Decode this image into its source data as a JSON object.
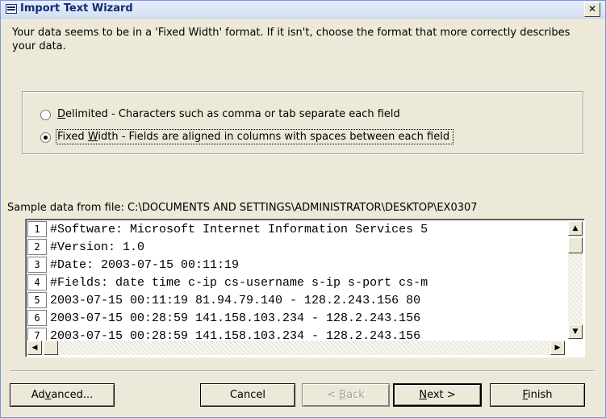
{
  "window": {
    "title": "Import Text Wizard",
    "close_glyph": "✕"
  },
  "intro": "Your data seems to be in a 'Fixed Width' format. If it isn't, choose the format that more correctly describes your data.",
  "options": {
    "delimited": {
      "label_prefix": "",
      "accel": "D",
      "label_rest": "elimited - Characters such as comma or tab separate each field",
      "selected": false
    },
    "fixed_width": {
      "label_prefix": "Fixed ",
      "accel": "W",
      "label_rest": "idth - Fields are aligned in columns with spaces between each field",
      "selected": true
    }
  },
  "sample": {
    "label": "Sample data from file: C:\\DOCUMENTS AND SETTINGS\\ADMINISTRATOR\\DESKTOP\\EX0307",
    "line_numbers": [
      "1",
      "2",
      "3",
      "4",
      "5",
      "6",
      "7"
    ],
    "lines": [
      "#Software: Microsoft Internet Information Services 5",
      "#Version: 1.0",
      "#Date: 2003-07-15 00:11:19",
      "#Fields: date time c-ip cs-username s-ip s-port cs-m",
      "2003-07-15 00:11:19 81.94.79.140 - 128.2.243.156 80",
      "2003-07-15 00:28:59 141.158.103.234 - 128.2.243.156",
      "2003-07-15 00:28:59 141.158.103.234 - 128.2.243.156"
    ]
  },
  "buttons": {
    "advanced": {
      "prefix": "Ad",
      "accel": "v",
      "rest": "anced..."
    },
    "cancel": {
      "prefix": "Cancel",
      "accel": "",
      "rest": ""
    },
    "back": {
      "prefix": "< ",
      "accel": "B",
      "rest": "ack"
    },
    "next": {
      "prefix": "",
      "accel": "N",
      "rest": "ext >"
    },
    "finish": {
      "prefix": "",
      "accel": "F",
      "rest": "inish"
    }
  },
  "icons": {
    "app": "table-icon",
    "close": "close-icon",
    "scroll_up": "▲",
    "scroll_down": "▼",
    "scroll_left": "◀",
    "scroll_right": "▶"
  }
}
